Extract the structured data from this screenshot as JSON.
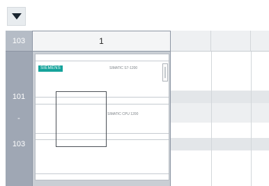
{
  "toolbar": {
    "dropdown_icon": "triangle-down-icon"
  },
  "rows": {
    "header": "103",
    "slot_101": "101",
    "separator": "-",
    "slot_103": "103"
  },
  "columns": {
    "first": "1"
  },
  "module": {
    "brand": "SIEMENS",
    "model": "SIMATIC S7-1200",
    "label2": "SIMATIC CPU 1200"
  },
  "colors": {
    "brand": "#15a39b",
    "header": "#9fa7b4"
  }
}
